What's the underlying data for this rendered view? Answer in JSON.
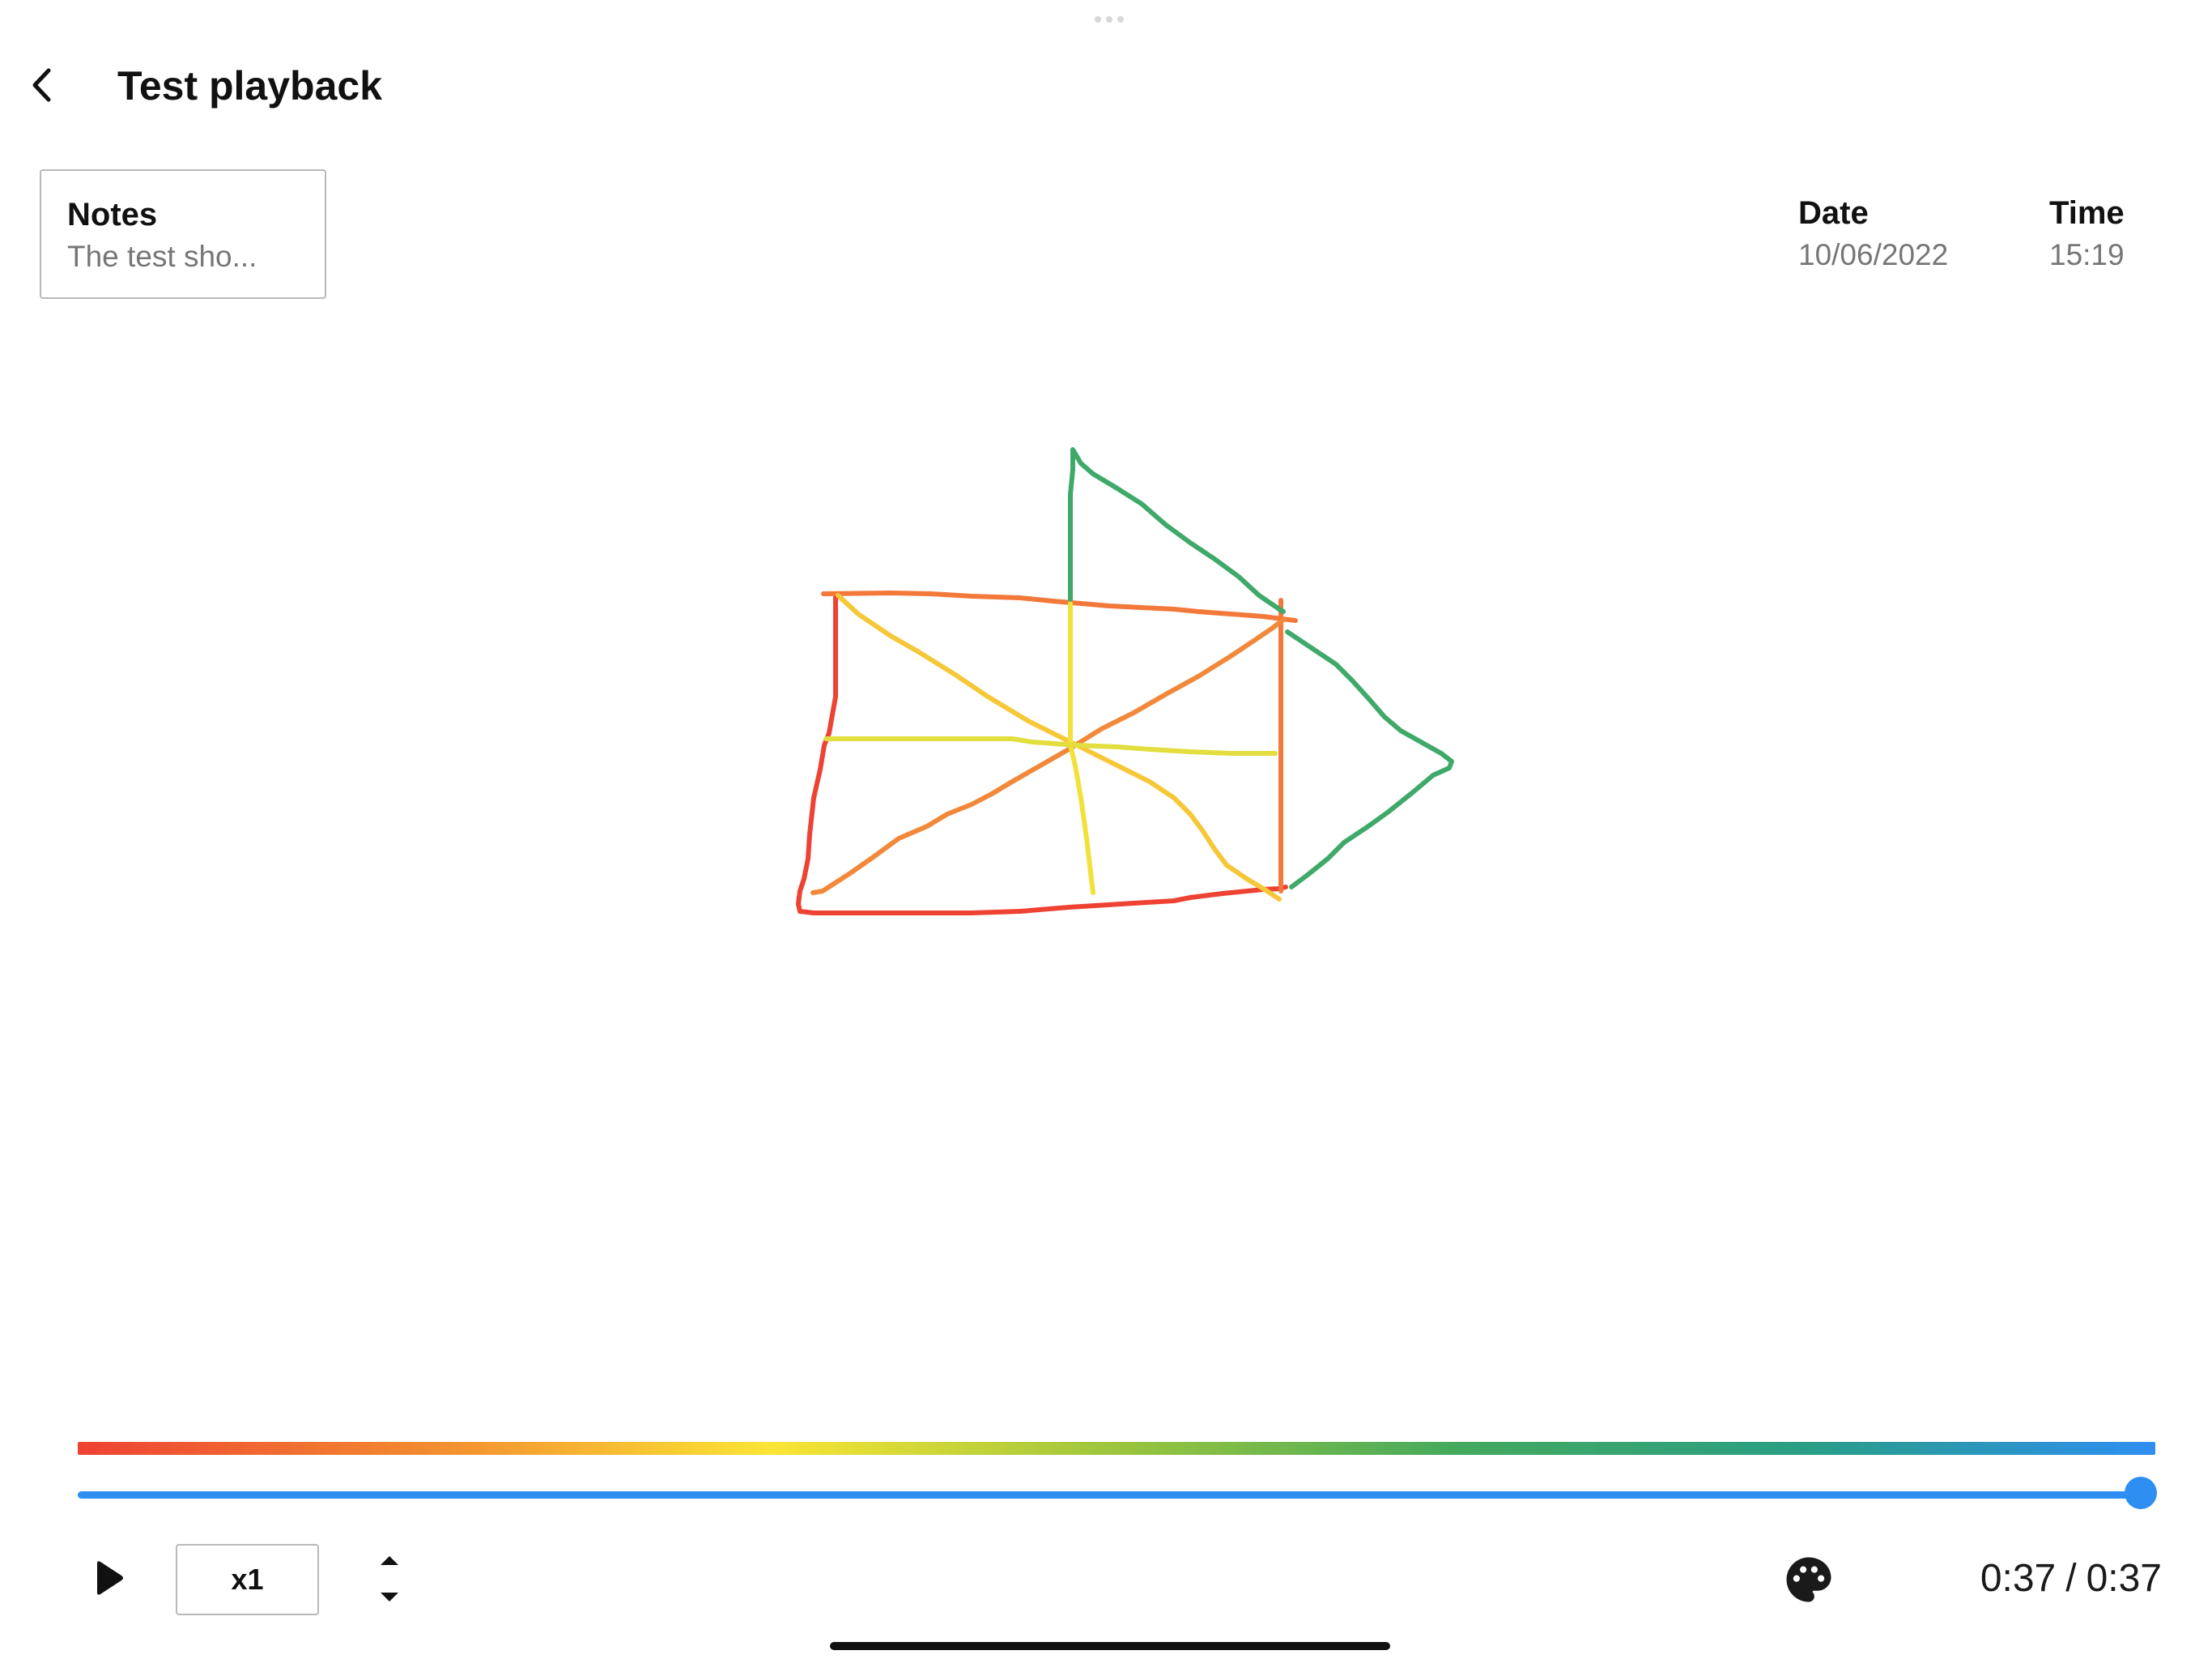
{
  "header": {
    "title": "Test playback",
    "back_icon": "chevron-left-icon"
  },
  "notes": {
    "label": "Notes",
    "preview": "The test sho..."
  },
  "meta": {
    "date_label": "Date",
    "date_value": "10/06/2022",
    "time_label": "Time",
    "time_value": "15:19"
  },
  "drawing": {
    "description_colors": [
      "#ee4233",
      "#f2793a",
      "#f7b531",
      "#f1e13a",
      "#3fa96a"
    ]
  },
  "timeline": {
    "gradient_colors": [
      "#ee4233",
      "#f28a30",
      "#fbe534",
      "#9bc53d",
      "#43a95e",
      "#2a9e86",
      "#2f8ef2"
    ],
    "progress": 1.0,
    "track_color": "#2f8ef2"
  },
  "controls": {
    "play_icon": "play-icon",
    "speed_label": "x1",
    "speed_up_icon": "caret-up-icon",
    "speed_down_icon": "caret-down-icon",
    "palette_icon": "palette-icon",
    "current_time": "0:37",
    "separator": "/",
    "total_time": "0:37"
  }
}
